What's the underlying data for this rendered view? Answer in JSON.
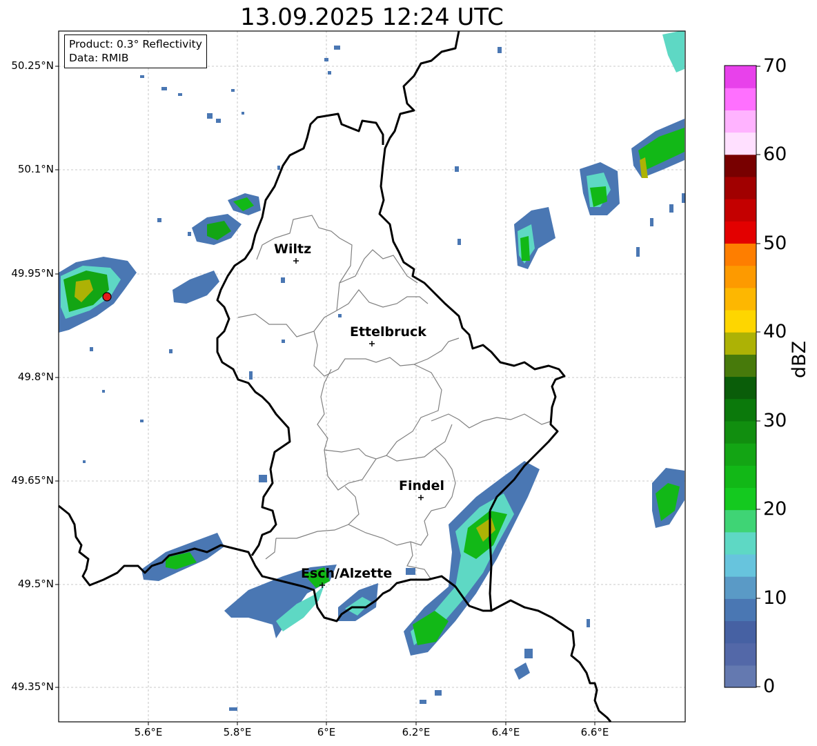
{
  "title": "13.09.2025 12:24 UTC",
  "info_box": {
    "product": "Product: 0.3° Reflectivity",
    "data": "Data: RMIB"
  },
  "axes": {
    "lat_labels": [
      "50.25°N",
      "50.1°N",
      "49.95°N",
      "49.8°N",
      "49.65°N",
      "49.5°N",
      "49.35°N"
    ],
    "lon_labels": [
      "5.6°E",
      "5.8°E",
      "6°E",
      "6.2°E",
      "6.4°E",
      "6.6°E"
    ],
    "grid": true
  },
  "cities": [
    {
      "name": "Wiltz",
      "lon": 5.93,
      "lat": 49.97
    },
    {
      "name": "Ettelbruck",
      "lon": 6.1,
      "lat": 49.85
    },
    {
      "name": "Findel",
      "lon": 6.21,
      "lat": 49.63
    },
    {
      "name": "Esch/Alzette",
      "lon": 5.98,
      "lat": 49.5
    }
  ],
  "radar_site": {
    "lon": 5.51,
    "lat": 49.92,
    "color": "#e31a1c"
  },
  "colorbar": {
    "label": "dBZ",
    "ticks": [
      "0",
      "10",
      "20",
      "30",
      "40",
      "50",
      "60",
      "70"
    ],
    "colors": [
      "#6479b0",
      "#5368a8",
      "#4661a3",
      "#4a77b3",
      "#5a9ac6",
      "#67c4dd",
      "#5ed8c4",
      "#3fd475",
      "#14c91f",
      "#12b817",
      "#13a514",
      "#118e0f",
      "#0b790b",
      "#0a5d09",
      "#477a0b",
      "#adb205",
      "#fed600",
      "#fdb701",
      "#fd9a00",
      "#fe7e00",
      "#e30000",
      "#c40000",
      "#a10000",
      "#780000",
      "#ffe0ff",
      "#ffb3ff",
      "#ff70ff",
      "#e841eb"
    ]
  },
  "colors": {
    "border_national": "#000000",
    "border_canton": "#808080",
    "grid": "#b0b0b0"
  }
}
